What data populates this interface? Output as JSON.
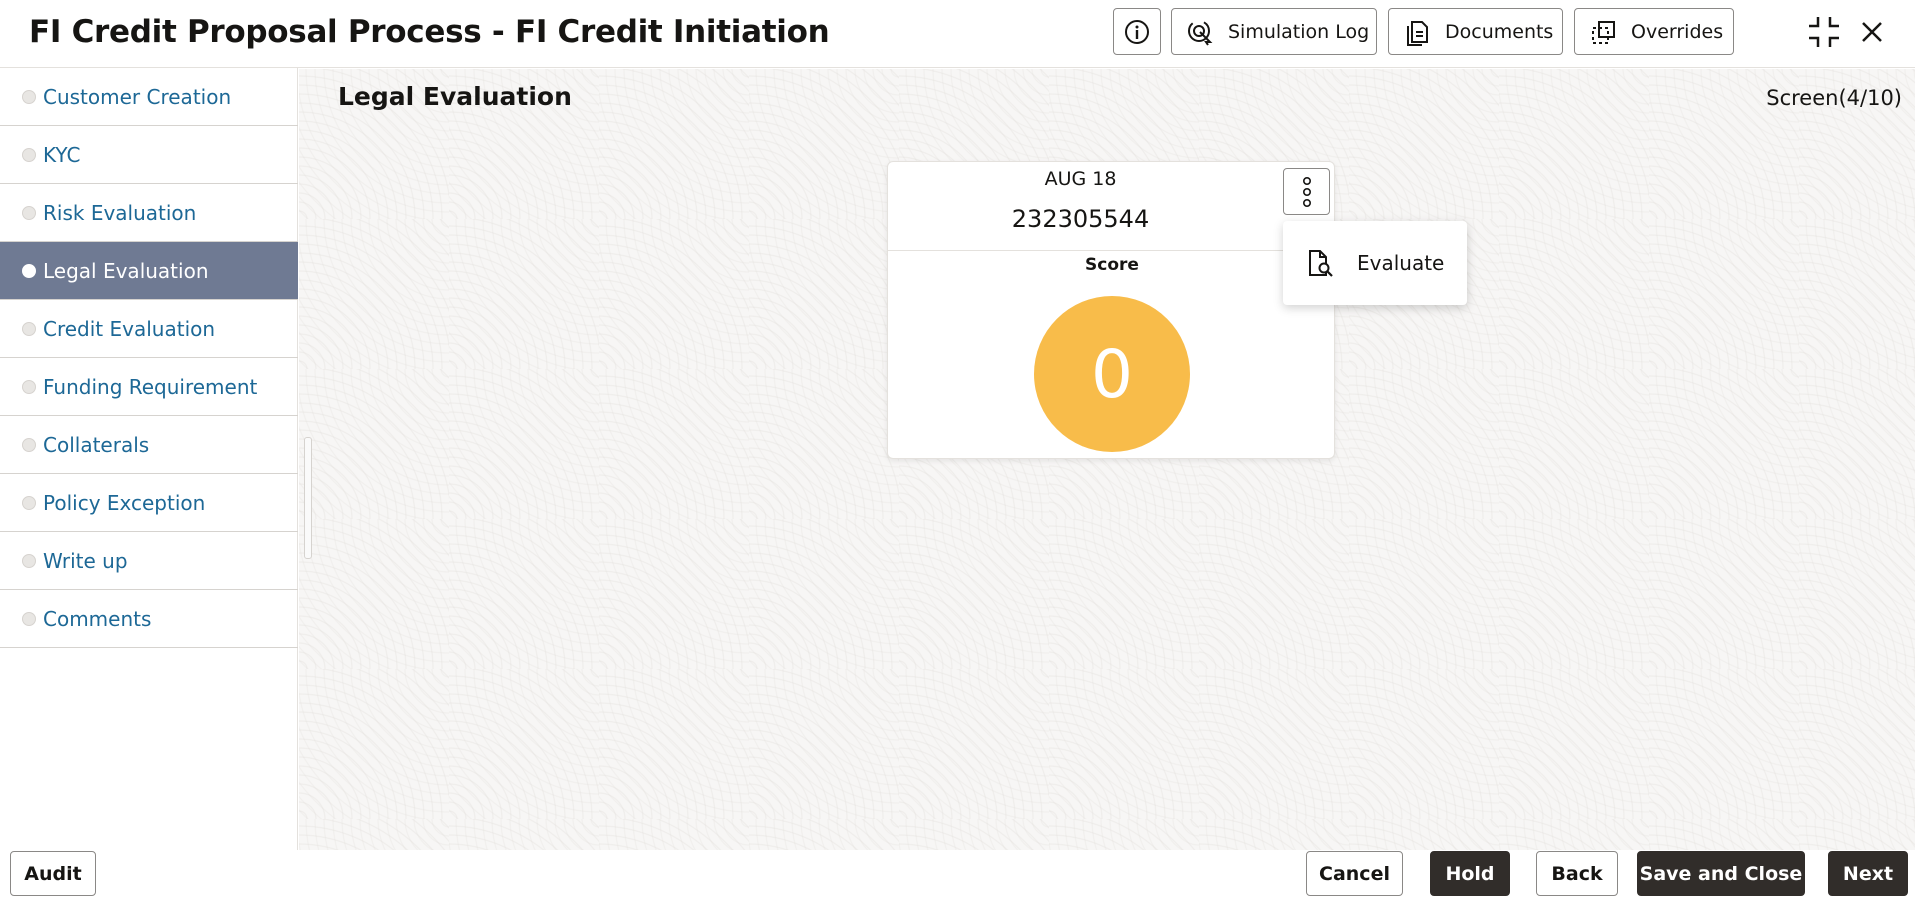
{
  "header": {
    "title": "FI Credit Proposal Process - FI Credit Initiation",
    "buttons": {
      "info_icon": "info-icon",
      "simulation_log": "Simulation Log",
      "documents": "Documents",
      "overrides": "Overrides"
    },
    "window_icons": [
      "shrink-icon",
      "close-icon"
    ]
  },
  "sidebar": {
    "items": [
      {
        "label": "Customer Creation"
      },
      {
        "label": "KYC"
      },
      {
        "label": "Risk Evaluation"
      },
      {
        "label": "Legal Evaluation",
        "active": true
      },
      {
        "label": "Credit Evaluation"
      },
      {
        "label": "Funding Requirement"
      },
      {
        "label": "Collaterals"
      },
      {
        "label": "Policy Exception"
      },
      {
        "label": "Write up"
      },
      {
        "label": "Comments"
      }
    ]
  },
  "main": {
    "title": "Legal Evaluation",
    "screen_counter": "Screen(4/10)",
    "card": {
      "date": "AUG 18",
      "id": "232305544",
      "score_label": "Score",
      "score_value": "0",
      "score_color": "#f8bc4a"
    },
    "menu": {
      "evaluate_label": "Evaluate"
    }
  },
  "footer": {
    "audit": "Audit",
    "cancel": "Cancel",
    "hold": "Hold",
    "back": "Back",
    "save_and_close": "Save and Close",
    "next": "Next"
  },
  "colors": {
    "active_nav_bg": "#6f7a93",
    "link": "#1d6896",
    "dark_button": "#312d2a"
  }
}
